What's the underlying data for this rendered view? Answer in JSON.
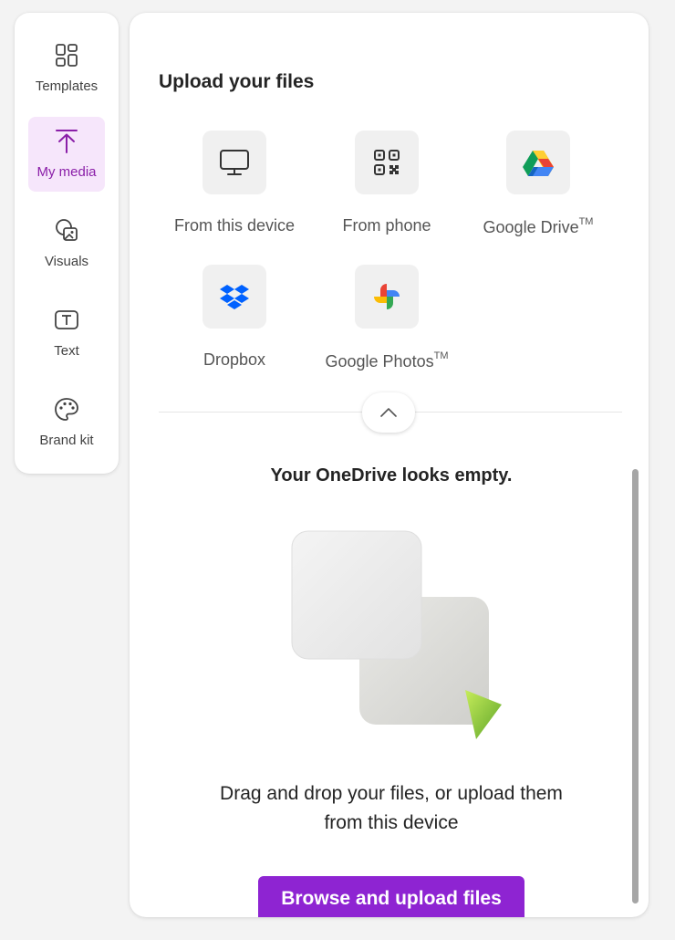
{
  "sidebar": {
    "items": [
      {
        "label": "Templates",
        "icon": "templates-icon",
        "active": false
      },
      {
        "label": "My media",
        "icon": "upload-icon",
        "active": true
      },
      {
        "label": "Visuals",
        "icon": "visuals-icon",
        "active": false
      },
      {
        "label": "Text",
        "icon": "text-icon",
        "active": false
      },
      {
        "label": "Brand kit",
        "icon": "palette-icon",
        "active": false
      }
    ]
  },
  "upload": {
    "title": "Upload your files",
    "sources": [
      {
        "label": "From this device",
        "icon": "monitor-icon"
      },
      {
        "label": "From phone",
        "icon": "qr-code-icon"
      },
      {
        "label": "Google Drive",
        "trademark": "TM",
        "icon": "google-drive-icon"
      },
      {
        "label": "Dropbox",
        "icon": "dropbox-icon"
      },
      {
        "label": "Google Photos",
        "trademark": "TM",
        "icon": "google-photos-icon"
      }
    ]
  },
  "empty_state": {
    "title": "Your OneDrive looks empty.",
    "line1": "Drag and drop your files, or upload them",
    "line2": "from this device",
    "button_label": "Browse and upload files"
  },
  "colors": {
    "accent": "#8e24d2",
    "active_bg": "#f6e6fb",
    "active_text": "#8a1ea8"
  }
}
